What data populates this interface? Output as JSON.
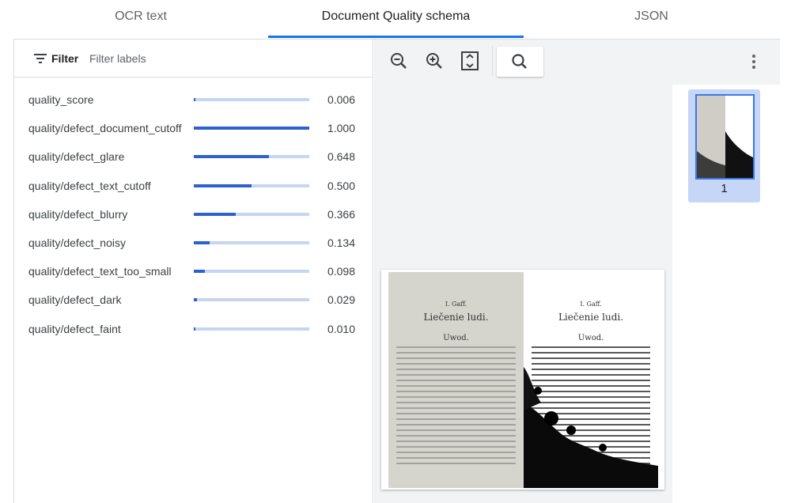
{
  "tabs": [
    {
      "label": "OCR text"
    },
    {
      "label": "Document Quality schema"
    },
    {
      "label": "JSON"
    }
  ],
  "filter": {
    "label": "Filter",
    "placeholder": "Filter labels"
  },
  "quality_rows": [
    {
      "label": "quality_score",
      "value_text": "0.006",
      "value": 0.006
    },
    {
      "label": "quality/defect_document_cutoff",
      "value_text": "1.000",
      "value": 1.0
    },
    {
      "label": "quality/defect_glare",
      "value_text": "0.648",
      "value": 0.648
    },
    {
      "label": "quality/defect_text_cutoff",
      "value_text": "0.500",
      "value": 0.5
    },
    {
      "label": "quality/defect_blurry",
      "value_text": "0.366",
      "value": 0.366
    },
    {
      "label": "quality/defect_noisy",
      "value_text": "0.134",
      "value": 0.134
    },
    {
      "label": "quality/defect_text_too_small",
      "value_text": "0.098",
      "value": 0.098
    },
    {
      "label": "quality/defect_dark",
      "value_text": "0.029",
      "value": 0.029
    },
    {
      "label": "quality/defect_faint",
      "value_text": "0.010",
      "value": 0.01
    }
  ],
  "toolbar": {
    "icons": [
      "zoom-out-icon",
      "zoom-in-icon",
      "fit-page-icon",
      "search-icon",
      "more-vert-icon"
    ]
  },
  "thumbnails": [
    {
      "page_number": "1"
    }
  ],
  "document": {
    "left_page": {
      "heading": "I. Gaff.",
      "title": "Liečenie ludi.",
      "subtitle": "Uwod."
    },
    "right_page": {
      "heading": "I. Gaff.",
      "title": "Liečenie ludi.",
      "subtitle": "Uwod."
    }
  },
  "colors": {
    "accent": "#1a73e8",
    "bar_fill": "#2c62cf",
    "bar_track": "#c6d6ee",
    "thumb_selected_bg": "#c5d6f7"
  }
}
